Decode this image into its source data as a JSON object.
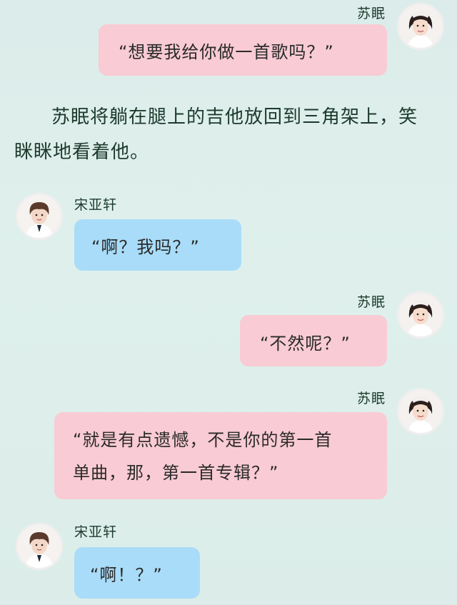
{
  "messages": [
    {
      "speaker": "苏眠",
      "side": "right",
      "text": "“想要我给你做一首歌吗？”"
    },
    {
      "speaker": "宋亚轩",
      "side": "left",
      "text": "“啊？我吗？”"
    },
    {
      "speaker": "苏眠",
      "side": "right",
      "text": "“不然呢？”"
    },
    {
      "speaker": "苏眠",
      "side": "right",
      "line1": "“就是有点遗憾，不是你的第一首",
      "line2": "单曲，那，第一首专辑？”"
    },
    {
      "speaker": "宋亚轩",
      "side": "left",
      "text": "“啊！？”"
    }
  ],
  "narration": {
    "line1": "苏眠将躺在腿上的吉他放回到三角架上，笑",
    "line2": "眯眯地看着他。"
  },
  "colors": {
    "background": "#dcece9",
    "pink_bubble": "#f9cbd4",
    "blue_bubble": "#a9dcf8",
    "name_text": "#1d3a2d"
  },
  "icons": {
    "female_avatar": "avatar-sumian",
    "male_avatar": "avatar-songyaxuan"
  }
}
